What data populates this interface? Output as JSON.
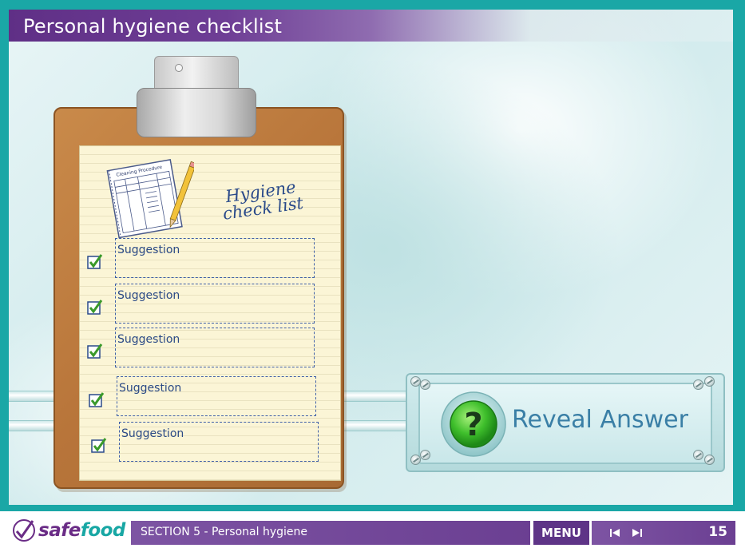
{
  "header": {
    "title": "Personal hygiene checklist"
  },
  "clipboard": {
    "heading": "Hygiene check list",
    "notepad_title": "Cleaning Procedure",
    "suggestions": [
      {
        "label": "Suggestion",
        "checked": true
      },
      {
        "label": "Suggestion",
        "checked": true
      },
      {
        "label": "Suggestion",
        "checked": true
      },
      {
        "label": "Suggestion",
        "checked": true
      },
      {
        "label": "Suggestion",
        "checked": true
      }
    ]
  },
  "reveal": {
    "label": "Reveal Answer",
    "icon": "question-mark-icon"
  },
  "footer": {
    "logo_safe": "safe",
    "logo_food": "food",
    "section_label": "SECTION 5 - Personal hygiene",
    "menu_label": "MENU",
    "page_number": "15"
  },
  "colors": {
    "frame": "#1aa7a6",
    "title_bar": "#5f2f86",
    "footer_bar": "#6b3f92",
    "suggestion_text": "#2b4a86",
    "reveal_text": "#3a7fa6",
    "check_green": "#3a9a2a"
  }
}
